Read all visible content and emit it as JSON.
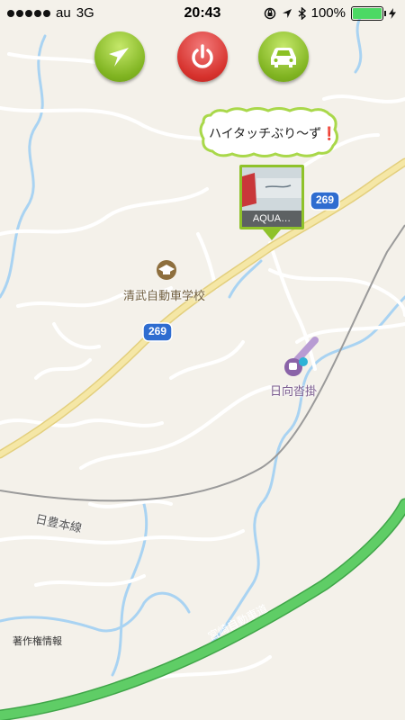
{
  "status_bar": {
    "carrier": "au",
    "network": "3G",
    "time": "20:43",
    "battery": "100%",
    "signal_bars": 5,
    "icons": [
      "orientation-lock-icon",
      "location-arrow-icon",
      "bluetooth-icon",
      "charging-icon"
    ]
  },
  "top_buttons": [
    {
      "name": "navigate-button",
      "icon": "navigation-arrow-icon",
      "color": "#8bc124"
    },
    {
      "name": "power-button",
      "icon": "power-icon",
      "color": "#d6312c"
    },
    {
      "name": "car-button",
      "icon": "car-icon",
      "color": "#8bc124"
    }
  ],
  "callout": {
    "text": "ハイタッチぶり〜ず",
    "emphasis": "❗"
  },
  "photo_pin": {
    "label": "AQUA…",
    "border_color": "#8fc22a"
  },
  "map": {
    "route_shields": [
      "269",
      "269"
    ],
    "school_label": "清武自動車学校",
    "station_label": "日向沓掛",
    "rail_label": "日豊本線",
    "expressway_label": "宮崎自動車道",
    "copyright": "著作権情報",
    "colors": {
      "background": "#f4f1ea",
      "road": "#ffffff",
      "main_road": "#f5e7a6",
      "expressway": "#5fcd66",
      "river": "#a9d3f2",
      "route_shield": "#2f6dd0"
    }
  }
}
